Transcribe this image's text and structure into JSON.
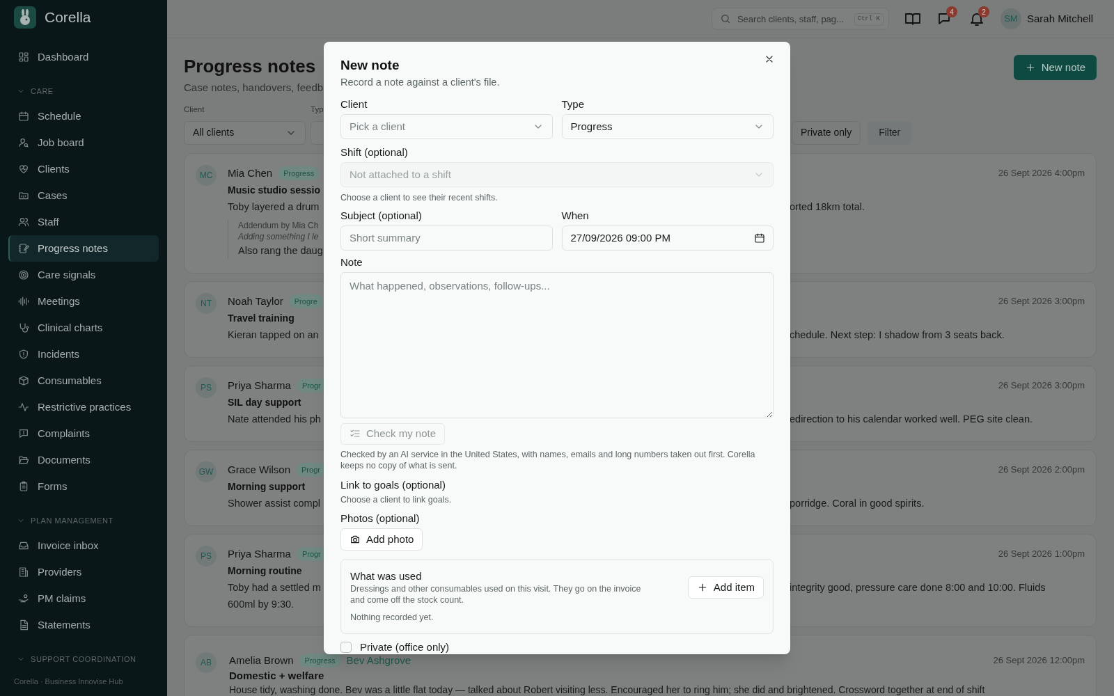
{
  "sidebar": {
    "brand": "Corella",
    "items": [
      {
        "kind": "link",
        "label": "Dashboard",
        "selected": false
      },
      {
        "kind": "section",
        "label": "CARE"
      },
      {
        "kind": "link",
        "label": "Schedule",
        "selected": false
      },
      {
        "kind": "link",
        "label": "Job board",
        "selected": false
      },
      {
        "kind": "link",
        "label": "Clients",
        "selected": false
      },
      {
        "kind": "link",
        "label": "Cases",
        "selected": false
      },
      {
        "kind": "link",
        "label": "Staff",
        "selected": false
      },
      {
        "kind": "link",
        "label": "Progress notes",
        "selected": true
      },
      {
        "kind": "link",
        "label": "Care signals",
        "selected": false
      },
      {
        "kind": "link",
        "label": "Meetings",
        "selected": false
      },
      {
        "kind": "link",
        "label": "Clinical charts",
        "selected": false
      },
      {
        "kind": "link",
        "label": "Incidents",
        "selected": false
      },
      {
        "kind": "link",
        "label": "Consumables",
        "selected": false
      },
      {
        "kind": "link",
        "label": "Restrictive practices",
        "selected": false
      },
      {
        "kind": "link",
        "label": "Complaints",
        "selected": false
      },
      {
        "kind": "link",
        "label": "Documents",
        "selected": false
      },
      {
        "kind": "link",
        "label": "Forms",
        "selected": false
      },
      {
        "kind": "section",
        "label": "PLAN MANAGEMENT"
      },
      {
        "kind": "link",
        "label": "Invoice inbox",
        "selected": false
      },
      {
        "kind": "link",
        "label": "Providers",
        "selected": false
      },
      {
        "kind": "link",
        "label": "PM claims",
        "selected": false
      },
      {
        "kind": "link",
        "label": "Statements",
        "selected": false
      },
      {
        "kind": "section",
        "label": "SUPPORT COORDINATION"
      }
    ],
    "footer": "Corella · Business Innovise Hub"
  },
  "header": {
    "search_placeholder": "Search clients, staff, pag...",
    "shortcut": "Ctrl K",
    "messages_badge": "4",
    "notifications_badge": "2",
    "user_initials": "SM",
    "user_name": "Sarah Mitchell"
  },
  "page": {
    "title": "Progress notes",
    "subtitle": "Case notes, handovers, feedb",
    "new_button": "New note",
    "filters": [
      {
        "label": "Client",
        "value": "All clients"
      },
      {
        "label": "Typ"
      }
    ],
    "private_button": "Private only",
    "filter_button": "Filter"
  },
  "notes": [
    {
      "kind": "split",
      "initials": "MC",
      "author": "Mia Chen",
      "badge": "Progress",
      "date": "26 Sept 2026 4:00pm",
      "title": "Music studio sessio",
      "lines": [
        "Toby layered a drum"
      ],
      "right_text": "orted 18km total.",
      "addendum": {
        "heading": "Addendum by Mia Ch",
        "quote": "Adding something I le",
        "text": "Also rang the daug"
      }
    },
    {
      "kind": "split",
      "initials": "NT",
      "author": "Noah Taylor",
      "badge": "Progre",
      "date": "26 Sept 2026 3:00pm",
      "title": "Travel training",
      "lines": [
        "Kieran tapped on an"
      ],
      "right_text": "chedule. Next step: I shadow from 3 seats back."
    },
    {
      "kind": "split",
      "initials": "PS",
      "author": "Priya Sharma",
      "badge": "Progr",
      "date": "26 Sept 2026 3:00pm",
      "title": "SIL day support",
      "lines": [
        "Nate attended his ph"
      ],
      "right_text": "edirection to his calendar worked well. PEG site clean."
    },
    {
      "kind": "split",
      "initials": "GW",
      "author": "Grace Wilson",
      "badge": "Progr",
      "date": "26 Sept 2026 2:00pm",
      "title": "Morning support",
      "lines": [
        "Shower assist compl"
      ],
      "right_text": "porridge. Coral in good spirits."
    },
    {
      "kind": "split",
      "initials": "PS",
      "author": "Priya Sharma",
      "badge": "Progr",
      "date": "26 Sept 2026 1:00pm",
      "title": "Morning routine",
      "lines": [
        "Toby had a settled m",
        "600ml by 9:30."
      ],
      "right_text": "integrity good, pressure care done 8:00 and 10:00. Fluids"
    },
    {
      "kind": "full",
      "initials": "AB",
      "author": "Amelia Brown",
      "badge": "Progress",
      "link": "Bev Ashgrove",
      "date": "26 Sept 2026 12:00pm",
      "title": "Domestic + welfare",
      "lines": [
        "House tidy, washing done. Bev was a little flat today — talked about Robert visiting less. Encouraged her to ring him; she did and brightened. Crossword together at end of shift"
      ]
    }
  ],
  "modal": {
    "title": "New note",
    "subtitle": "Record a note against a client's file.",
    "client": {
      "label": "Client",
      "placeholder": "Pick a client"
    },
    "type": {
      "label": "Type",
      "value": "Progress"
    },
    "shift": {
      "label": "Shift (optional)",
      "placeholder": "Not attached to a shift",
      "disabled": true,
      "hint": "Choose a client to see their recent shifts."
    },
    "subject": {
      "label": "Subject (optional)",
      "placeholder": "Short summary"
    },
    "when": {
      "label": "When",
      "value": "27/09/2026 09:00 PM"
    },
    "note": {
      "label": "Note",
      "placeholder": "What happened, observations, follow-ups..."
    },
    "check_button": {
      "label": "Check my note",
      "disabled": true
    },
    "disclaimer": "Checked by an AI service in the United States, with names, emails and long numbers taken out first. Corella keeps no copy of what is sent.",
    "goals": {
      "label": "Link to goals (optional)",
      "hint": "Choose a client to link goals."
    },
    "photos": {
      "label": "Photos (optional)",
      "button": "Add photo"
    },
    "used": {
      "title": "What was used",
      "description": "Dressings and other consumables used on this visit. They go on the invoice and come off the stock count.",
      "empty": "Nothing recorded yet.",
      "button": "Add item"
    },
    "private": {
      "label": "Private (office only)",
      "checked": false
    }
  }
}
